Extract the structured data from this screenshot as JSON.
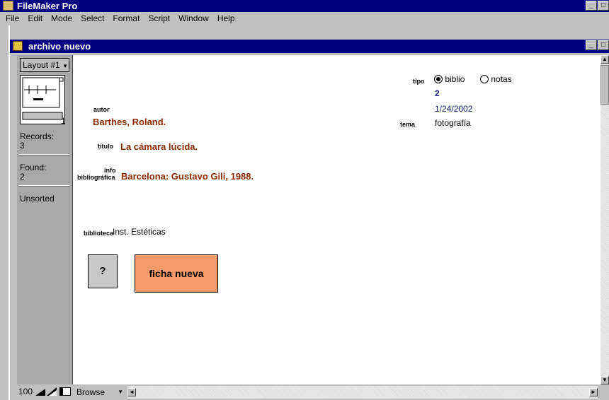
{
  "app": {
    "title": "FileMaker Pro",
    "min": "_",
    "max": "□"
  },
  "menu": [
    "File",
    "Edit",
    "Mode",
    "Select",
    "Format",
    "Script",
    "Window",
    "Help"
  ],
  "document": {
    "title": "archivo nuevo"
  },
  "status": {
    "layout_label": "Layout #1",
    "book_page": "1",
    "records_label": "Records:",
    "records_value": "3",
    "found_label": "Found:",
    "found_value": "2",
    "sort_state": "Unsorted"
  },
  "record": {
    "autor_label": "autor",
    "autor_value": "Barthes, Roland.",
    "titulo_label": "título",
    "titulo_value": "La cámara lúcida.",
    "info_label_1": "info",
    "info_label_2": "bibliográfica",
    "info_value": "Barcelona: Gustavo Gili, 1988.",
    "biblioteca_label": "biblioteca",
    "biblioteca_value": "Inst. Estéticas",
    "tipo_label": "tipo",
    "tipo_option_1": "biblio",
    "tipo_option_2": "notas",
    "tipo_selected": "biblio",
    "record_number": "2",
    "date": "1/24/2002",
    "tema_label": "tema",
    "tema_value": "fotografía"
  },
  "buttons": {
    "help": "?",
    "new_record": "ficha nueva"
  },
  "bottom": {
    "zoom": "100",
    "mode": "Browse"
  },
  "colors": {
    "titlebar": "#000080",
    "field_brown": "#8b2a00",
    "button_orange": "#f79a6a"
  }
}
